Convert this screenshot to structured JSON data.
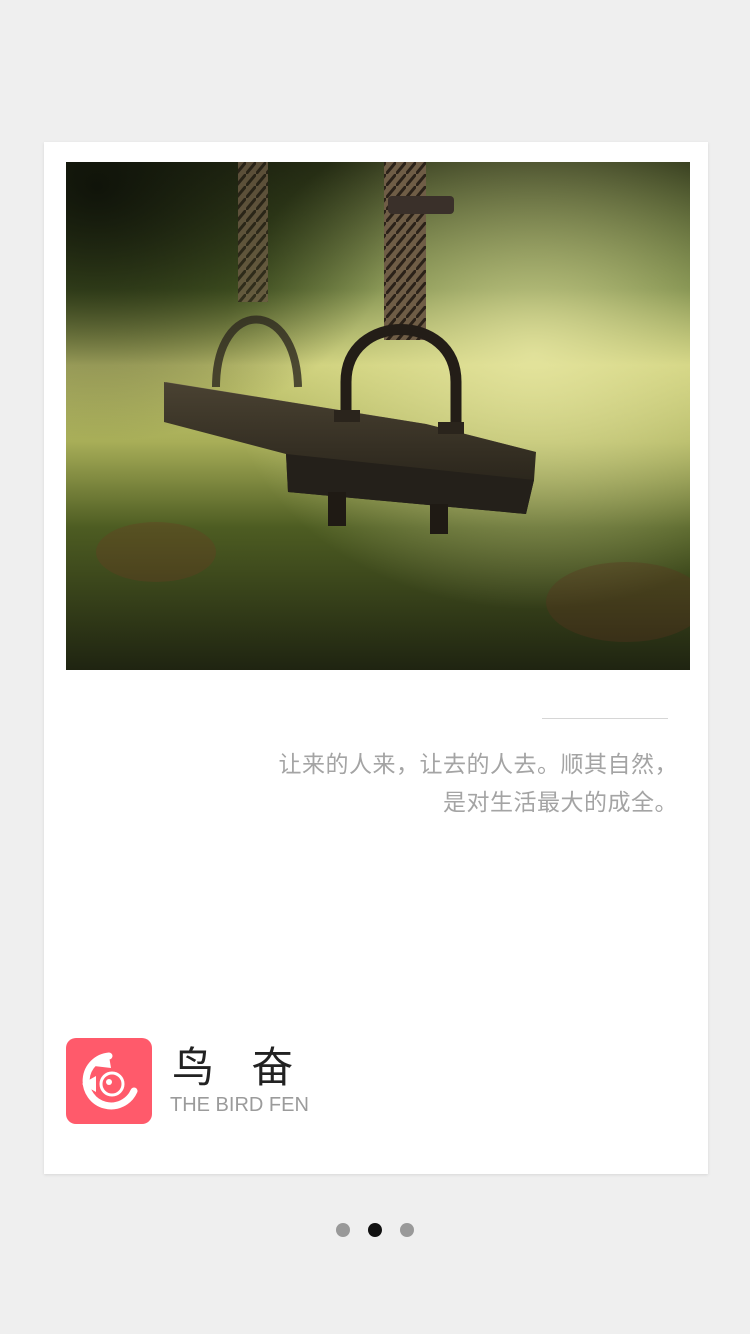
{
  "photo": {
    "subject": "wooden-swing-photo"
  },
  "quote": {
    "line1": "让来的人来，让去的人去。顺其自然，",
    "line2": "是对生活最大的成全。"
  },
  "brand": {
    "name": "鸟 奋",
    "subtitle": "THE BIRD FEN",
    "logo_color": "#ff5a6b"
  },
  "pager": {
    "count": 3,
    "active_index": 1
  }
}
